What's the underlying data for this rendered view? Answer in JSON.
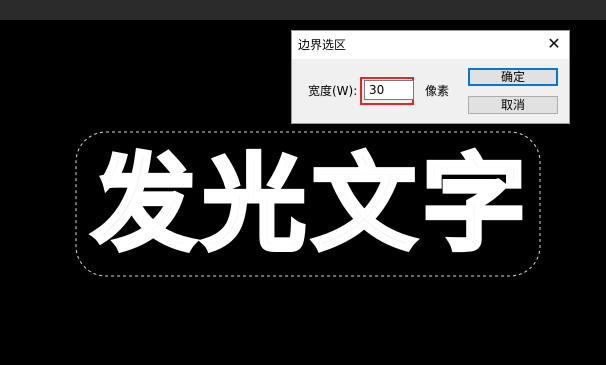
{
  "canvas": {
    "text": "发光文字"
  },
  "dialog": {
    "title": "边界选区",
    "close_glyph": "✕",
    "width_label": "宽度(W):",
    "width_value": "30",
    "unit_label": "像素",
    "ok_label": "确定",
    "cancel_label": "取消"
  },
  "colors": {
    "background": "#000000",
    "text": "#f3f3f3",
    "highlight": "#e8242b",
    "accent": "#0078d7"
  }
}
